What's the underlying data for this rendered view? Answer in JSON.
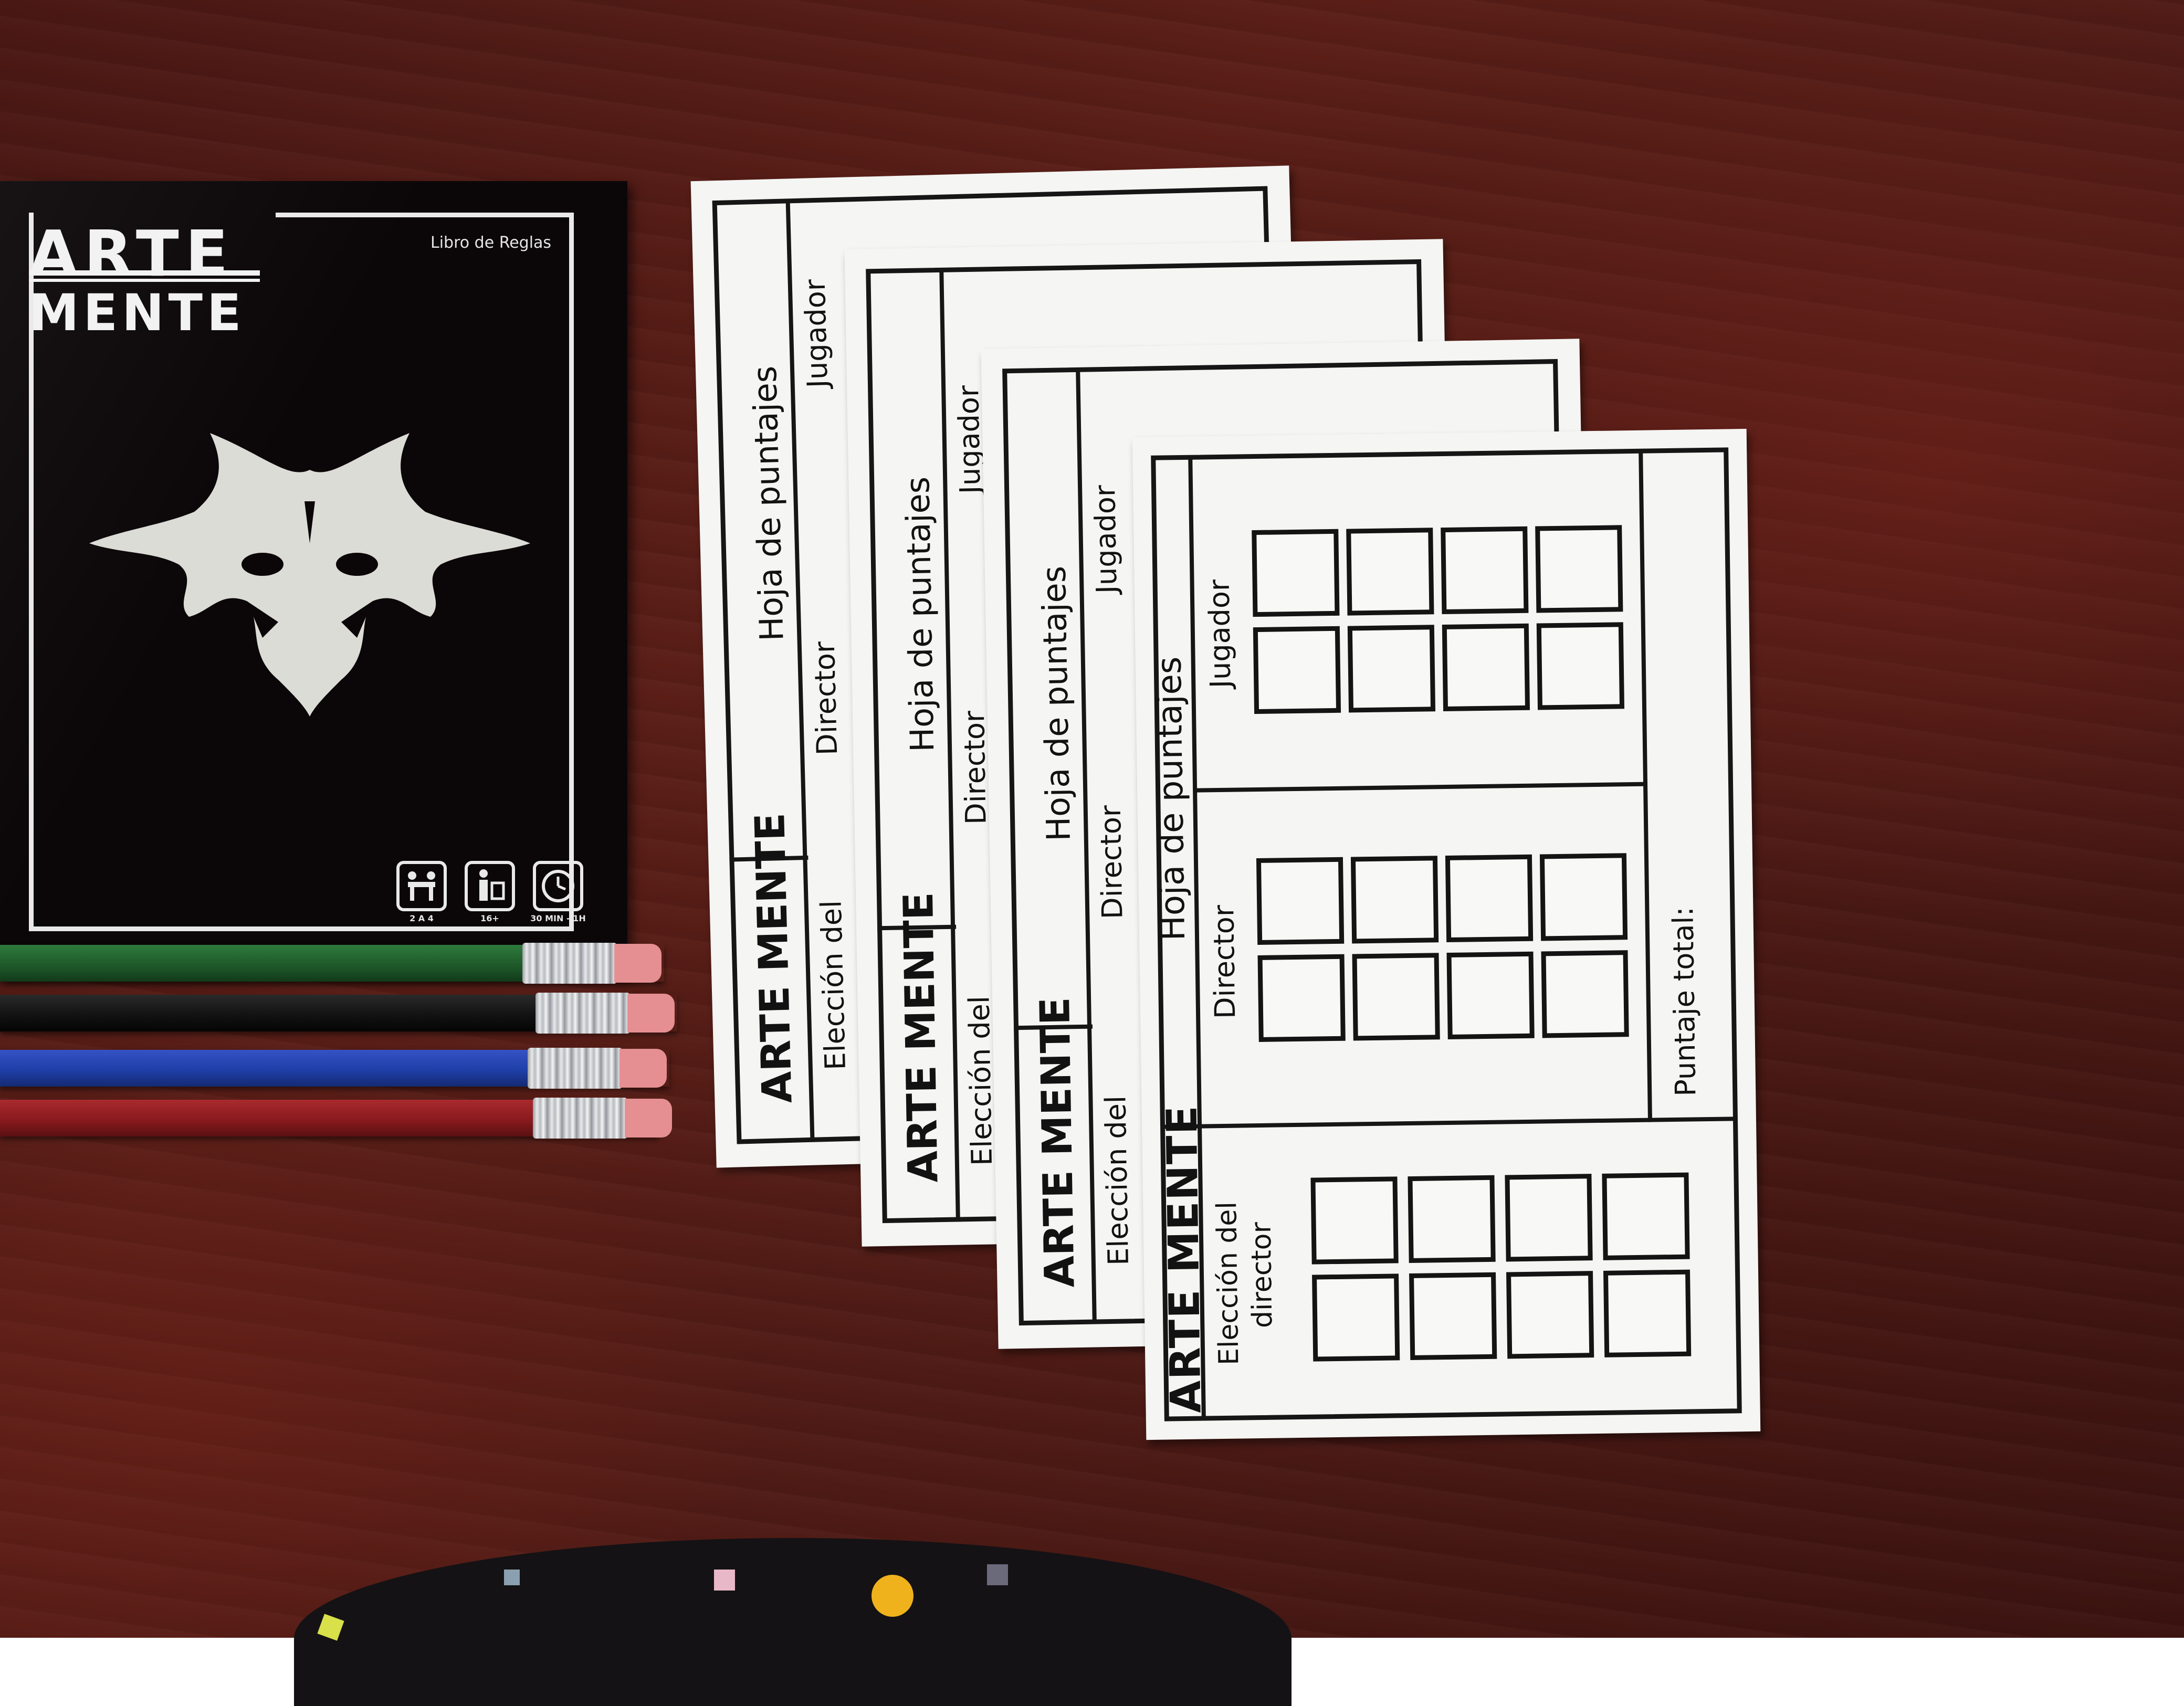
{
  "booklet": {
    "logo_top": "ARTE",
    "logo_bottom": "MENTE",
    "subtitle": "Libro de Reglas",
    "icons": [
      {
        "name": "players-icon",
        "label": "2 A 4"
      },
      {
        "name": "age-icon",
        "label": "16+"
      },
      {
        "name": "clock-icon",
        "label": "30 MIN - 1H"
      }
    ]
  },
  "pencils": [
    {
      "color": "#1f5a2a"
    },
    {
      "color": "#121212"
    },
    {
      "color": "#1f3fa8"
    },
    {
      "color": "#8a1a1e"
    }
  ],
  "sheet": {
    "title": "Hoja de puntajes",
    "logo": "ARTE MENTE",
    "player_label": "Jugador",
    "director_label": "Director",
    "director_choice_label_1": "Elección del",
    "director_choice_label_2": "director",
    "total_label": "Puntaje total:"
  },
  "colors": {
    "table": "#4d1a15",
    "paper": "#f5f5f3",
    "ink": "#141414",
    "booklet": "#0b0709"
  }
}
